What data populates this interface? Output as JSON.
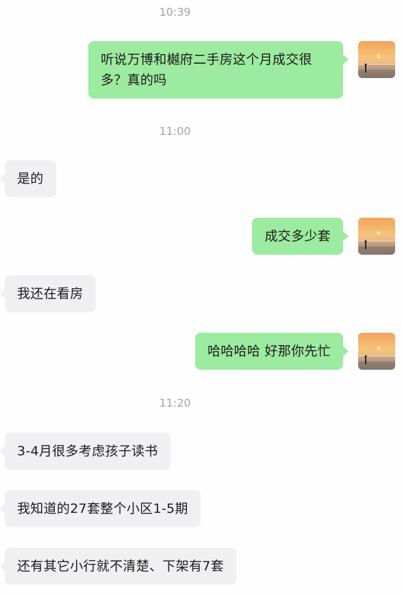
{
  "messages": [
    {
      "type": "timestamp",
      "text": "10:39"
    },
    {
      "type": "outgoing",
      "text": "听说万博和樾府二手房这个月成交很多？真的吗"
    },
    {
      "type": "timestamp",
      "text": "11:00"
    },
    {
      "type": "incoming",
      "text": "是的"
    },
    {
      "type": "outgoing",
      "text": "成交多少套"
    },
    {
      "type": "incoming",
      "text": "我还在看房"
    },
    {
      "type": "outgoing",
      "text": "哈哈哈哈 好那你先忙"
    },
    {
      "type": "timestamp",
      "text": "11:20"
    },
    {
      "type": "incoming",
      "text": "3-4月很多考虑孩子读书"
    },
    {
      "type": "incoming",
      "text": "我知道的27套整个小区1-5期"
    },
    {
      "type": "incoming",
      "text": "还有其它小行就不清楚、下架有7套"
    }
  ],
  "colors": {
    "outgoing_bubble": "#9ceba0",
    "incoming_bubble": "#f0f0f2",
    "timestamp_text": "#a3a3a3",
    "background": "#fefefe"
  },
  "avatar": {
    "icon": "sunset-beach-avatar"
  }
}
